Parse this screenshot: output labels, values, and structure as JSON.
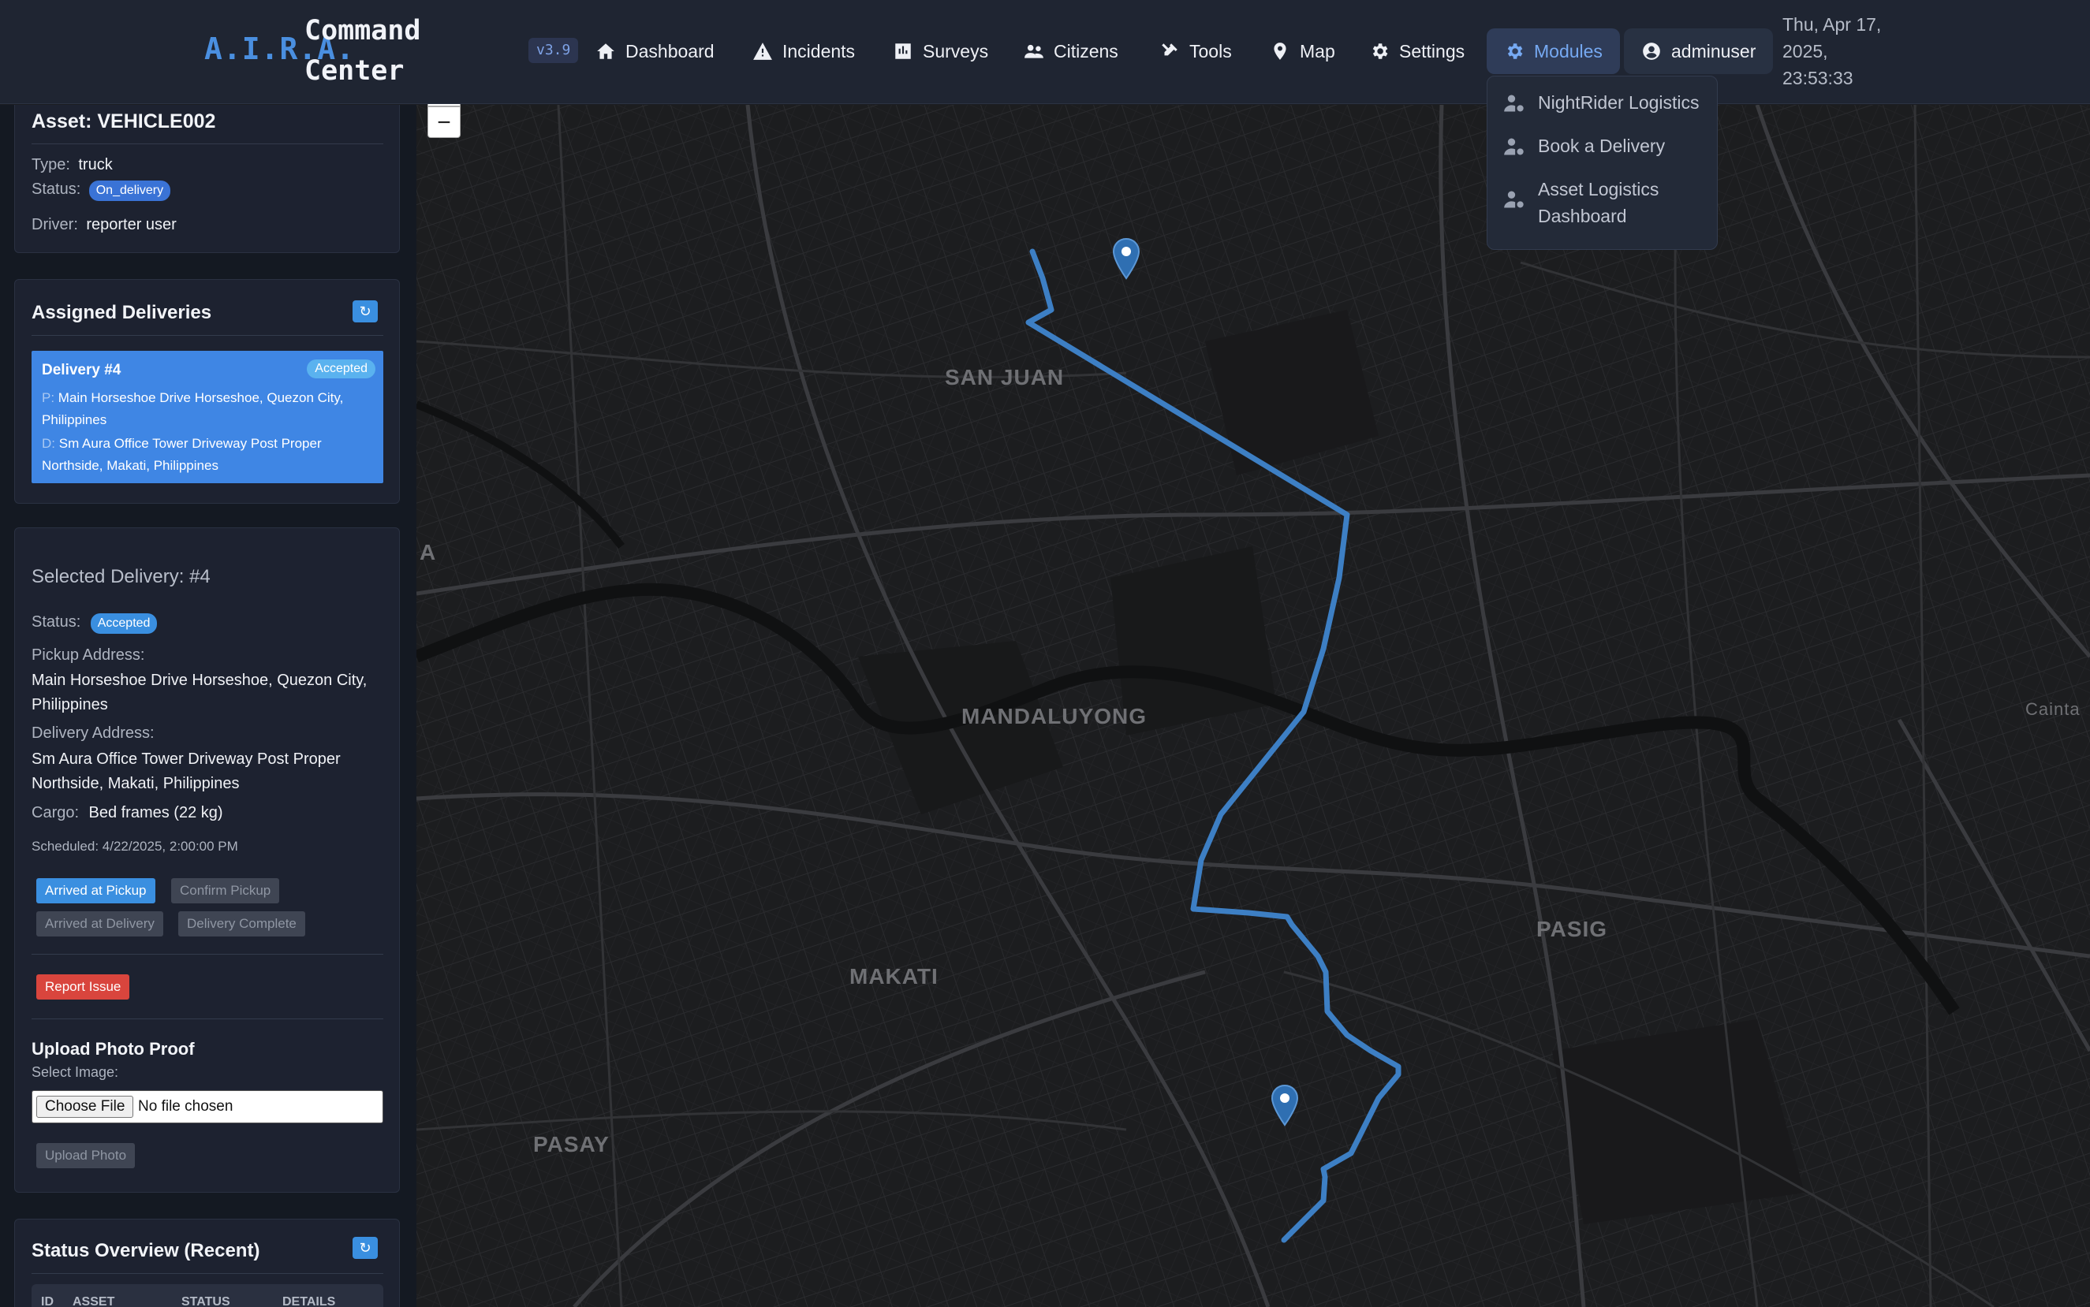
{
  "header": {
    "brand_aira": "A.I.R.A.",
    "brand_title": "Command Center",
    "version": "v3.9",
    "nav": [
      {
        "label": "Dashboard",
        "icon": "home-icon"
      },
      {
        "label": "Incidents",
        "icon": "warning-icon"
      },
      {
        "label": "Surveys",
        "icon": "poll-icon"
      },
      {
        "label": "Citizens",
        "icon": "users-icon"
      },
      {
        "label": "Tools",
        "icon": "tools-icon"
      },
      {
        "label": "Map",
        "icon": "map-pin-icon"
      },
      {
        "label": "Settings",
        "icon": "gear-icon"
      },
      {
        "label": "Modules",
        "icon": "gear-icon"
      }
    ],
    "user": "adminuser",
    "clock": "Thu, Apr 17, 2025, 23:53:33"
  },
  "modules_menu": [
    "NightRider Logistics",
    "Book a Delivery",
    "Asset Logistics Dashboard"
  ],
  "asset": {
    "title": "Asset: VEHICLE002",
    "type_label": "Type:",
    "type": "truck",
    "status_label": "Status:",
    "status": "On_delivery",
    "driver_label": "Driver:",
    "driver": "reporter user"
  },
  "assigned": {
    "title": "Assigned Deliveries",
    "refresh": "↻",
    "item": {
      "title": "Delivery #4",
      "badge": "Accepted",
      "pickup_prefix": "P:",
      "pickup": "Main Horseshoe Drive Horseshoe, Quezon City, Philippines",
      "dropoff_prefix": "D:",
      "dropoff": "Sm Aura Office Tower Driveway Post Proper Northside, Makati, Philippines"
    }
  },
  "selected": {
    "title": "Selected Delivery: #4",
    "status_label": "Status:",
    "status": "Accepted",
    "pickup_label": "Pickup Address:",
    "pickup": "Main Horseshoe Drive Horseshoe, Quezon City, Philippines",
    "delivery_label": "Delivery Address:",
    "delivery": "Sm Aura Office Tower Driveway Post Proper Northside, Makati, Philippines",
    "cargo_label": "Cargo:",
    "cargo": "Bed frames (22 kg)",
    "scheduled": "Scheduled: 4/22/2025, 2:00:00 PM",
    "buttons": {
      "arrived_pickup": "Arrived at Pickup",
      "confirm_pickup": "Confirm Pickup",
      "arrived_delivery": "Arrived at Delivery",
      "delivery_complete": "Delivery Complete",
      "report_issue": "Report Issue"
    },
    "upload_title": "Upload Photo Proof",
    "select_image": "Select Image:",
    "choose_file": "Choose File",
    "no_file": "No file chosen",
    "upload_button": "Upload Photo"
  },
  "status_overview": {
    "title": "Status Overview (Recent)",
    "refresh": "↻",
    "columns": [
      "ID",
      "ASSET",
      "STATUS",
      "DETAILS"
    ]
  },
  "map": {
    "zoom_in": "+",
    "zoom_out": "−",
    "labels": [
      "SAN JUAN",
      "MANDALUYONG",
      "MAKATI",
      "PASIG",
      "PASAY",
      "Cainta",
      "A"
    ],
    "route_color": "#3d7fc4"
  }
}
